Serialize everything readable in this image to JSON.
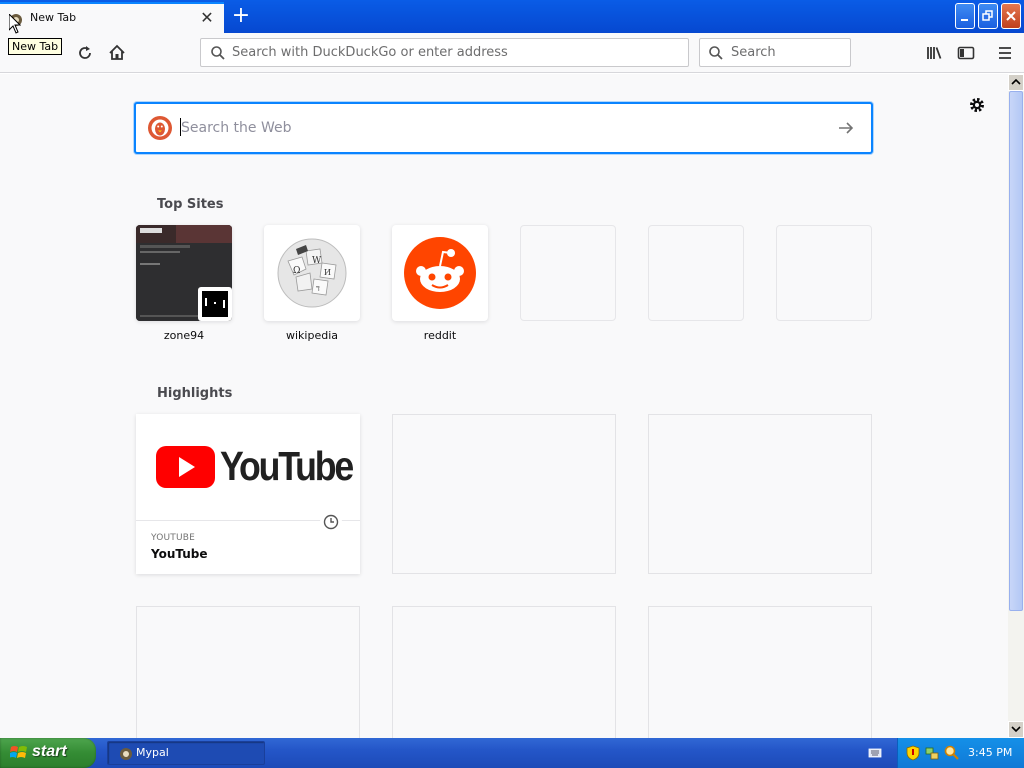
{
  "window": {
    "tab_title": "New Tab",
    "tooltip": "New Tab"
  },
  "toolbar": {
    "url_placeholder": "Search with DuckDuckGo or enter address",
    "search_placeholder": "Search"
  },
  "newtab": {
    "websearch_placeholder": "Search the Web",
    "top_sites_title": "Top Sites",
    "top_sites": [
      {
        "label": "zone94"
      },
      {
        "label": "wikipedia"
      },
      {
        "label": "reddit"
      }
    ],
    "highlights_title": "Highlights",
    "highlight": {
      "logo_text": "YouTube",
      "host": "YOUTUBE",
      "title": "YouTube"
    }
  },
  "taskbar": {
    "start_label": "start",
    "task_label": "Mypal",
    "clock": "3:45 PM"
  },
  "colors": {
    "accent": "#0a84ff",
    "titlebar": "#0648d0",
    "reddit": "#ff4500",
    "youtube_red": "#ff0000"
  }
}
